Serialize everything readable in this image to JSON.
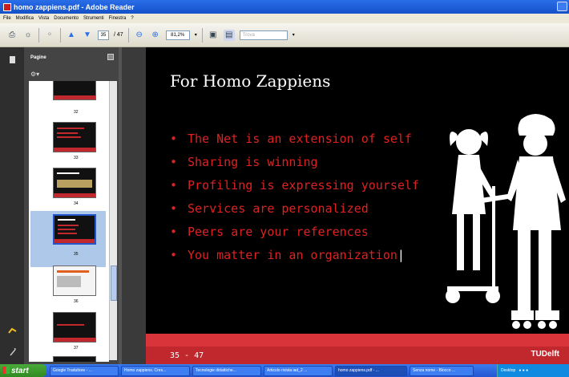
{
  "window": {
    "title": "homo zappiens.pdf - Adobe Reader"
  },
  "menu": [
    "File",
    "Modifica",
    "Vista",
    "Documento",
    "Strumenti",
    "Finestra",
    "?"
  ],
  "toolbar": {
    "page_current": "35",
    "page_total": "/ 47",
    "zoom": "81,2%",
    "search_placeholder": "Trova"
  },
  "panel": {
    "title": "Pagine",
    "options_icon": "gear-icon"
  },
  "thumbnails": [
    {
      "label": "32"
    },
    {
      "label": "33"
    },
    {
      "label": "34"
    },
    {
      "label": "35",
      "selected": true
    },
    {
      "label": "36"
    },
    {
      "label": "37"
    }
  ],
  "slide": {
    "title": "For Homo Zappiens",
    "bullets": [
      "The Net is an extension of self",
      "Sharing is winning",
      "Profiling is expressing yourself",
      "Services are personalized",
      "Peers are your references",
      "You matter in an organization"
    ],
    "page_indicator": "35 - 47",
    "logo": "TUDelft"
  },
  "taskbar": {
    "start": "start",
    "tasks": [
      "Google Traduttore - ...",
      "Homo zappiens. Cres...",
      "Tecnologie didattiche...",
      "Articolo rivista iad_2 ...",
      "homo zappiens.pdf - ...",
      "Senza nome - Blocco ..."
    ],
    "tray_text": "Desktop"
  },
  "colors": {
    "accent_red": "#c0282d",
    "slide_bg": "#000000",
    "bullet_text": "#dd2222"
  }
}
